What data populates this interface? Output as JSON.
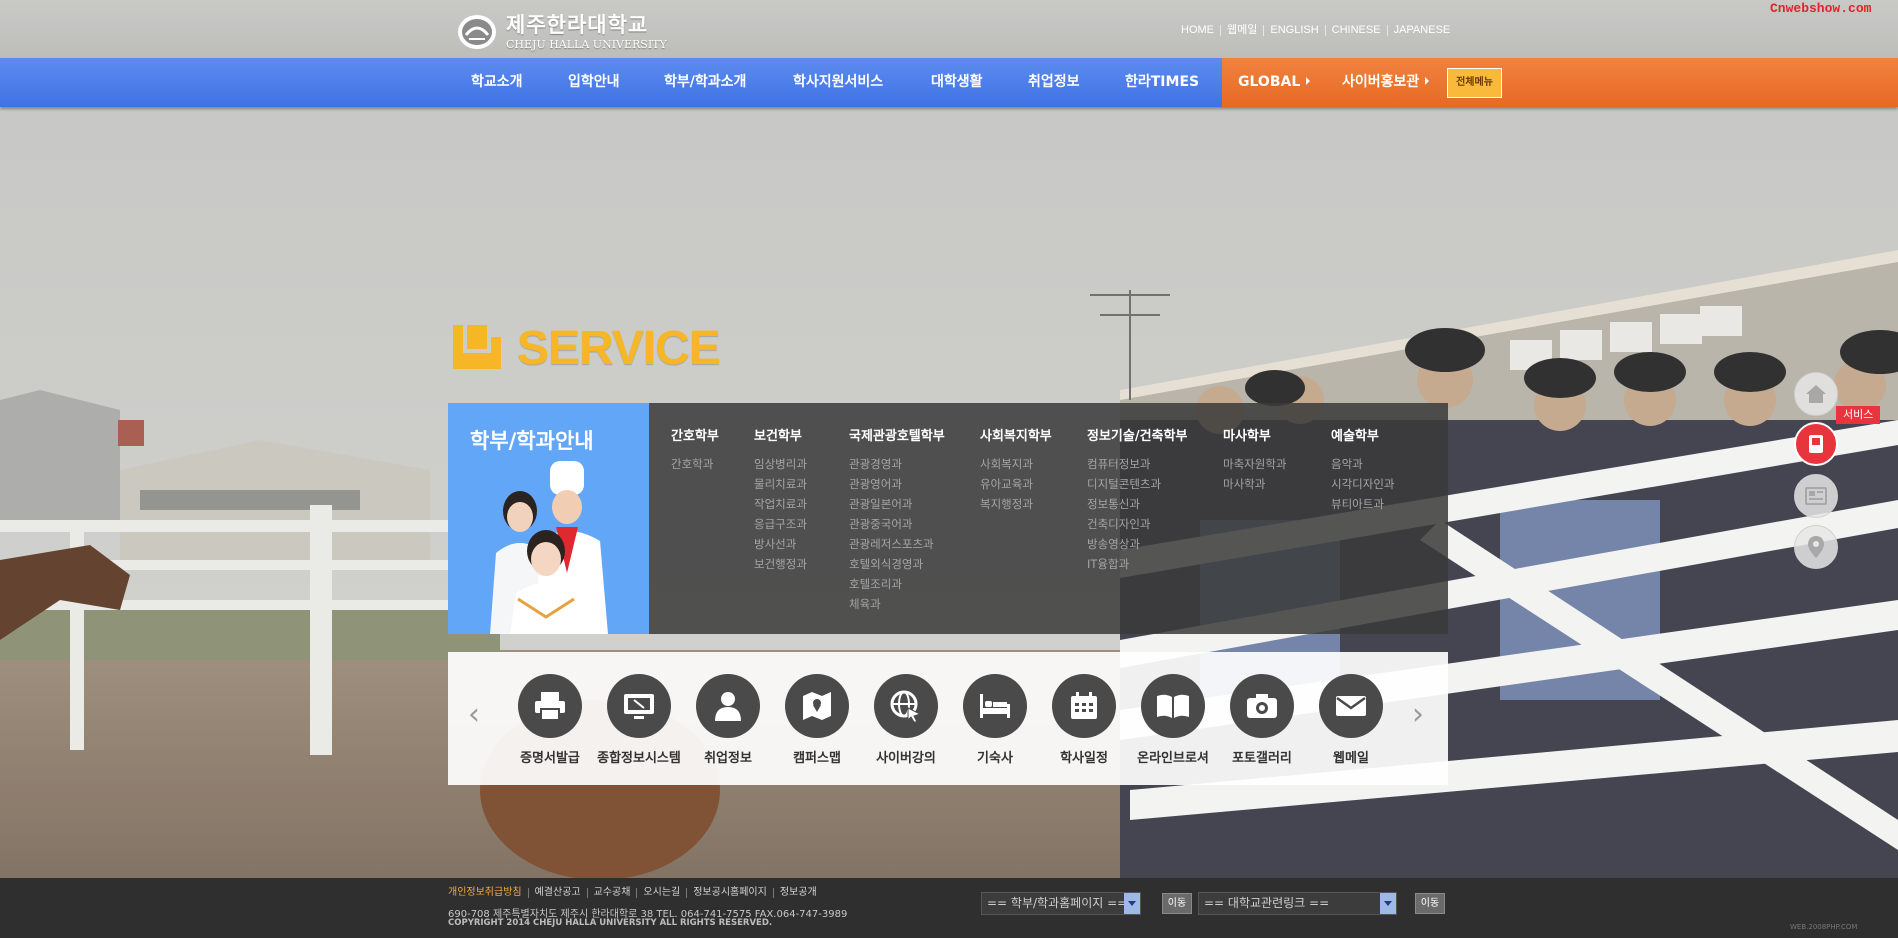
{
  "header": {
    "watermark": "Cnwebshow.com",
    "logo_korean": "제주한라대학교",
    "logo_english": "CHEJU HALLA UNIVERSITY",
    "top_links": [
      "HOME",
      "웹메일",
      "ENGLISH",
      "CHINESE",
      "JAPANESE"
    ]
  },
  "nav": {
    "items": [
      "학교소개",
      "입학안내",
      "학부/학과소개",
      "학사지원서비스",
      "대학생활",
      "취업정보",
      "한라TIMES"
    ],
    "global_label": "GLOBAL",
    "cyber_label": "사이버홍보관",
    "all_menu_label": "전체메뉴"
  },
  "service": {
    "heading": "SERVICE",
    "panel_title": "학부/학과안내",
    "departments": [
      {
        "title": "간호학부",
        "items": [
          "간호학과"
        ]
      },
      {
        "title": "보건학부",
        "items": [
          "임상병리과",
          "물리치료과",
          "작업치료과",
          "응급구조과",
          "방사선과",
          "보건행정과"
        ]
      },
      {
        "title": "국제관광호텔학부",
        "items": [
          "관광경영과",
          "관광영어과",
          "관광일본어과",
          "관광중국어과",
          "관광레저스포츠과",
          "호텔외식경영과",
          "호텔조리과",
          "체육과"
        ]
      },
      {
        "title": "사회복지학부",
        "items": [
          "사회복지과",
          "유아교육과",
          "복지행정과"
        ]
      },
      {
        "title": "정보기술/건축학부",
        "items": [
          "컴퓨터정보과",
          "디지털콘텐츠과",
          "정보통신과",
          "건축디자인과",
          "방송영상과",
          "IT융합과"
        ]
      },
      {
        "title": "마사학부",
        "items": [
          "마축자원학과",
          "마사학과"
        ]
      },
      {
        "title": "예술학부",
        "items": [
          "음악과",
          "시각디자인과",
          "뷰티아트과"
        ]
      }
    ],
    "quick_links": [
      {
        "label": "증명서발급",
        "icon": "printer-icon"
      },
      {
        "label": "종합정보시스템",
        "icon": "monitor-icon"
      },
      {
        "label": "취업정보",
        "icon": "person-icon"
      },
      {
        "label": "캠퍼스맵",
        "icon": "map-icon"
      },
      {
        "label": "사이버강의",
        "icon": "globe-cursor-icon"
      },
      {
        "label": "기숙사",
        "icon": "bed-icon"
      },
      {
        "label": "학사일정",
        "icon": "calendar-icon"
      },
      {
        "label": "온라인브로셔",
        "icon": "book-icon"
      },
      {
        "label": "포토갤러리",
        "icon": "camera-icon"
      },
      {
        "label": "웹메일",
        "icon": "mail-icon"
      }
    ],
    "prev_arrow": "‹",
    "next_arrow": "›"
  },
  "side": {
    "tag": "서비스",
    "buttons": [
      "home-icon",
      "service-icon",
      "news-icon",
      "location-icon"
    ]
  },
  "footer": {
    "links": [
      "개인정보취급방침",
      "예결산공고",
      "교수공채",
      "오시는길",
      "정보공시홈페이지",
      "정보공개"
    ],
    "address": "690-708 제주특별자치도 제주시 한라대학로 38    TEL. 064-741-7575    FAX.064-747-3989",
    "copyright": "COPYRIGHT 2014 CHEJU HALLA UNIVERSITY ALL RIGHTS RESERVED.",
    "select1": "==  학부/학과홈페이지  ==",
    "select2": "==  대학교관련링크  ==",
    "go_label": "이동",
    "corner": "WEB.2008PHP.COM"
  },
  "colors": {
    "nav_blue": "#4a7ce9",
    "nav_orange": "#ec7530",
    "service_yellow": "#f6b626",
    "dept_blue": "#62a6f8",
    "accent_red": "#e8343c"
  }
}
